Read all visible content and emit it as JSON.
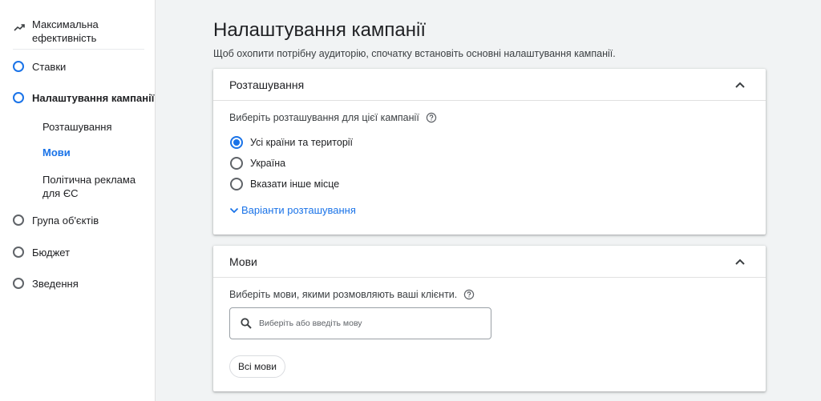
{
  "sidebar": {
    "performance_label": "Максимальна ефективність",
    "steps": [
      {
        "label": "Ставки",
        "active": false
      },
      {
        "label": "Налаштування кампанії",
        "active": true
      },
      {
        "label": "Група об'єктів",
        "active": false
      },
      {
        "label": "Бюджет",
        "active": false
      },
      {
        "label": "Зведення",
        "active": false
      }
    ],
    "sub_items": [
      {
        "label": "Розташування",
        "active": false
      },
      {
        "label": "Мови",
        "active": true
      },
      {
        "label": "Політична реклама для ЄС",
        "active": false
      }
    ]
  },
  "main": {
    "title": "Налаштування кампанії",
    "subtitle": "Щоб охопити потрібну аудиторію, спочатку встановіть основні налаштування кампанії."
  },
  "location_card": {
    "title": "Розташування",
    "question": "Виберіть розташування для цієї кампанії",
    "options": [
      {
        "label": "Усі країни та території",
        "checked": true
      },
      {
        "label": "Україна",
        "checked": false
      },
      {
        "label": "Вказати інше місце",
        "checked": false
      }
    ],
    "more_link": "Варіанти розташування"
  },
  "languages_card": {
    "title": "Мови",
    "question": "Виберіть мови, якими розмовляють ваші клієнти.",
    "search_placeholder": "Виберіть або введіть мову",
    "chip_label": "Всі мови"
  },
  "colors": {
    "accent": "#1a73e8",
    "background": "#f1f3f4",
    "text": "#202124"
  }
}
